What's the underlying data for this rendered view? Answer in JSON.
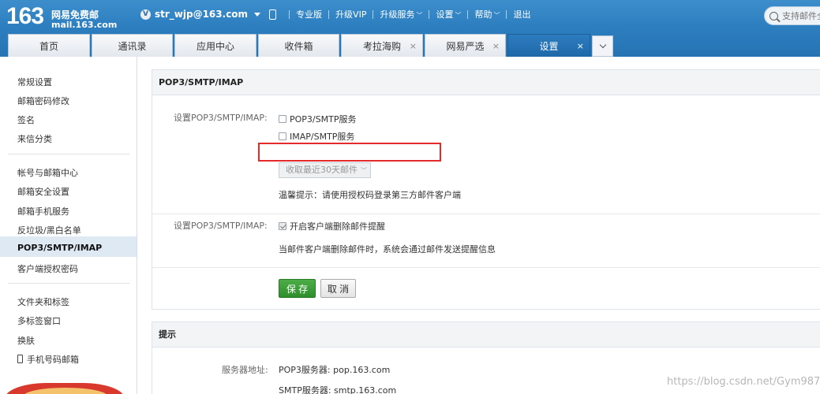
{
  "header": {
    "logo_number": "163",
    "logo_cn": "网易免费邮",
    "logo_domain": "mail.163.com",
    "avatar_letter": "V",
    "account": "str_wjp@163.com",
    "nav": [
      "专业版",
      "升级VIP",
      "升级服务",
      "设置",
      "帮助",
      "退出"
    ],
    "search_placeholder": "支持邮件全"
  },
  "tabs": [
    {
      "label": "首页"
    },
    {
      "label": "通讯录"
    },
    {
      "label": "应用中心"
    },
    {
      "label": "收件箱"
    },
    {
      "label": "考拉海购"
    },
    {
      "label": "网易严选"
    },
    {
      "label": "设置"
    }
  ],
  "close_glyph": "×",
  "sidebar": {
    "items": [
      "常规设置",
      "邮箱密码修改",
      "签名",
      "来信分类",
      "帐号与邮箱中心",
      "邮箱安全设置",
      "邮箱手机服务",
      "反垃圾/黑白名单",
      "POP3/SMTP/IMAP",
      "客户端授权密码",
      "文件夹和标签",
      "多标签窗口",
      "换肤",
      "手机号码邮箱"
    ]
  },
  "pop_panel": {
    "title": "POP3/SMTP/IMAP",
    "row1_label": "设置POP3/SMTP/IMAP:",
    "opt_pop3": "POP3/SMTP服务",
    "opt_imap": "IMAP/SMTP服务",
    "select_value": "收取最近30天邮件",
    "tip": "温馨提示：请使用授权码登录第三方邮件客户端",
    "row2_label": "设置POP3/SMTP/IMAP:",
    "opt_delete": "开启客户端删除邮件提醒",
    "delete_note": "当邮件客户端删除邮件时，系统会通过邮件发送提醒信息",
    "save": "保 存",
    "cancel": "取 消"
  },
  "tips_panel": {
    "title": "提示",
    "server_label": "服务器地址:",
    "pop3_server": "POP3服务器: pop.163.com",
    "smtp_server": "SMTP服务器: smtp.163.com"
  },
  "watermark": "https://blog.csdn.net/Gym987"
}
